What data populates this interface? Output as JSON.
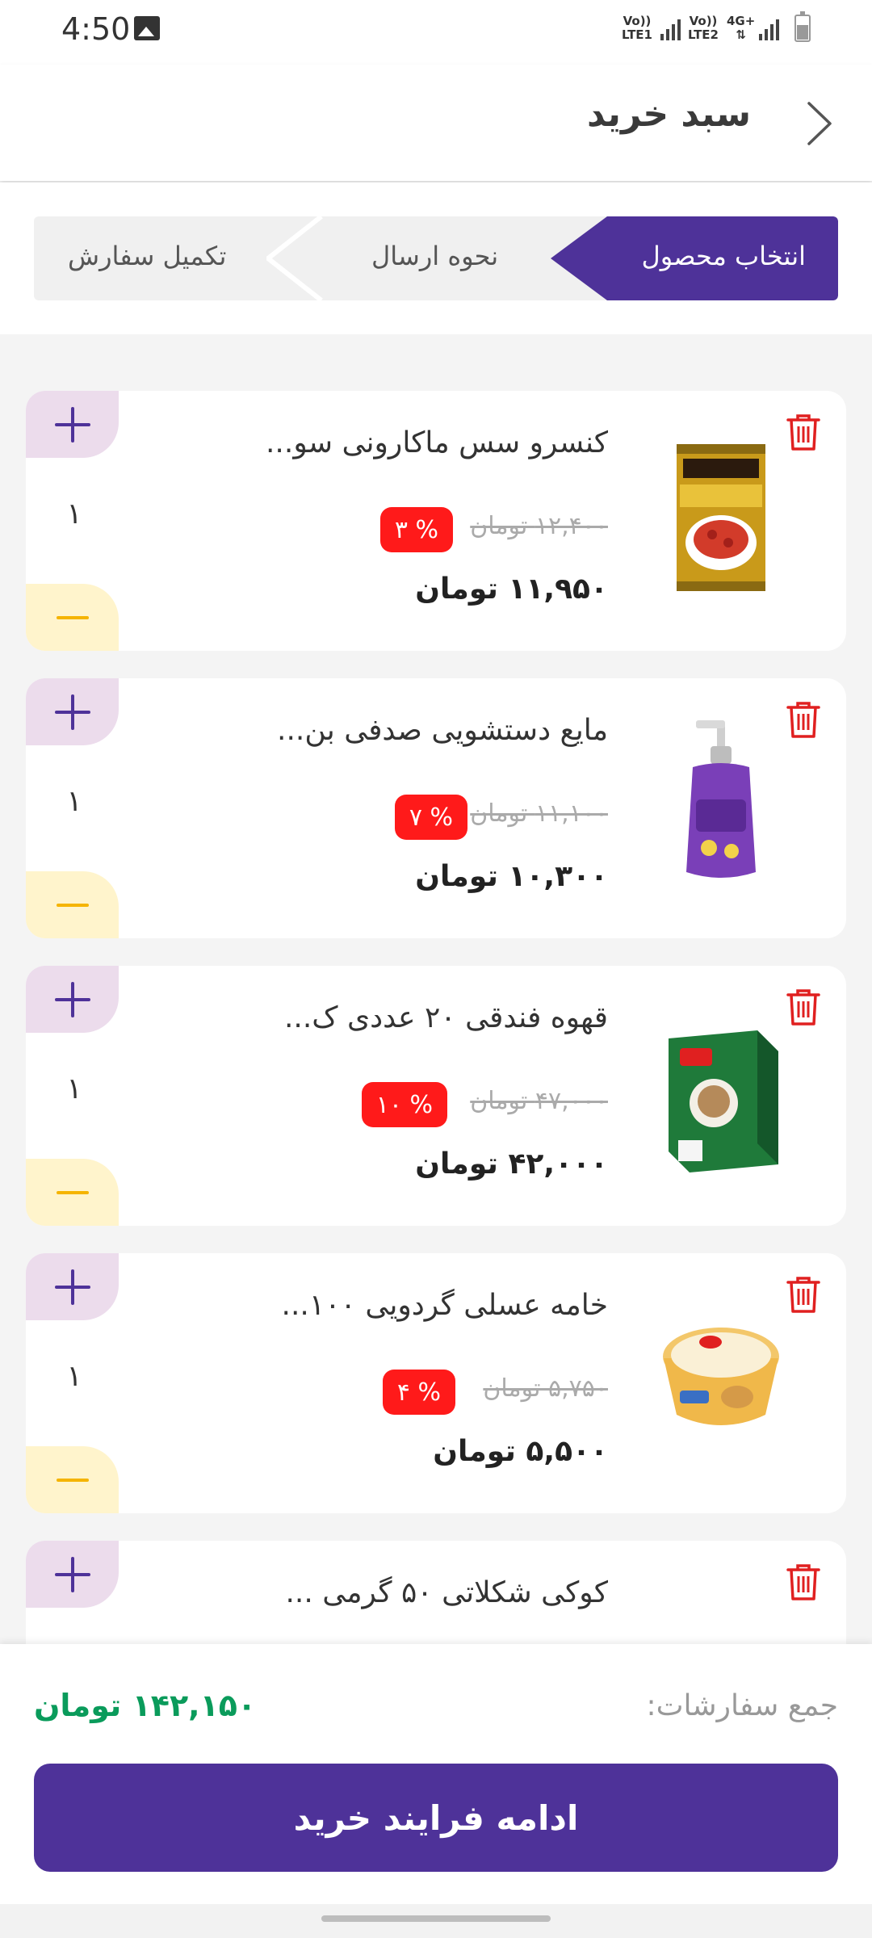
{
  "status_bar": {
    "time": "4:50",
    "sim1_top": "Vo))",
    "sim1_bottom": "LTE1",
    "sim2_top": "Vo))",
    "sim2_bottom": "LTE2",
    "network": "4G+"
  },
  "header": {
    "title": "سبد خرید"
  },
  "steps": [
    {
      "label": "انتخاب محصول",
      "active": true
    },
    {
      "label": "نحوه ارسال",
      "active": false
    },
    {
      "label": "تکمیل سفارش",
      "active": false
    }
  ],
  "cart_items": [
    {
      "name": "کنسرو سس ماکارونی سو...",
      "old_price": "۱۲,۴۰۰ تومان",
      "discount": "% ۳",
      "price": "۱۱,۹۵۰ تومان",
      "quantity": "۱",
      "image": "canned-pasta-sauce"
    },
    {
      "name": "مایع دستشویی صدفی بن...",
      "old_price": "۱۱,۱۰۰ تومان",
      "discount": "% ۷",
      "price": "۱۰,۳۰۰ تومان",
      "quantity": "۱",
      "image": "hand-wash-bottle"
    },
    {
      "name": "قهوه فندقی ۲۰ عددی ک...",
      "old_price": "۴۷,۰۰۰ تومان",
      "discount": "% ۱۰",
      "price": "۴۲,۰۰۰ تومان",
      "quantity": "۱",
      "image": "coffee-box"
    },
    {
      "name": "خامه عسلی گردویی ۱۰۰...",
      "old_price": "۵,۷۵۰ تومان",
      "discount": "% ۴",
      "price": "۵,۵۰۰ تومان",
      "quantity": "۱",
      "image": "cream-cup"
    },
    {
      "name": "کوکی شکلاتی ۵۰ گرمی ...",
      "image": "cookie-pack"
    }
  ],
  "footer": {
    "total_label": "جمع سفارشات:",
    "total_value": "۱۴۲,۱۵۰ تومان",
    "cta_label": "ادامه فرایند خرید"
  },
  "colors": {
    "primary": "#4e3299",
    "discount": "#ff1a1a",
    "total": "#0a9b5b",
    "plus_bg": "#ecdcec",
    "minus_bg": "#fff4cc",
    "minus_icon": "#f5b400",
    "trash": "#e02020"
  }
}
